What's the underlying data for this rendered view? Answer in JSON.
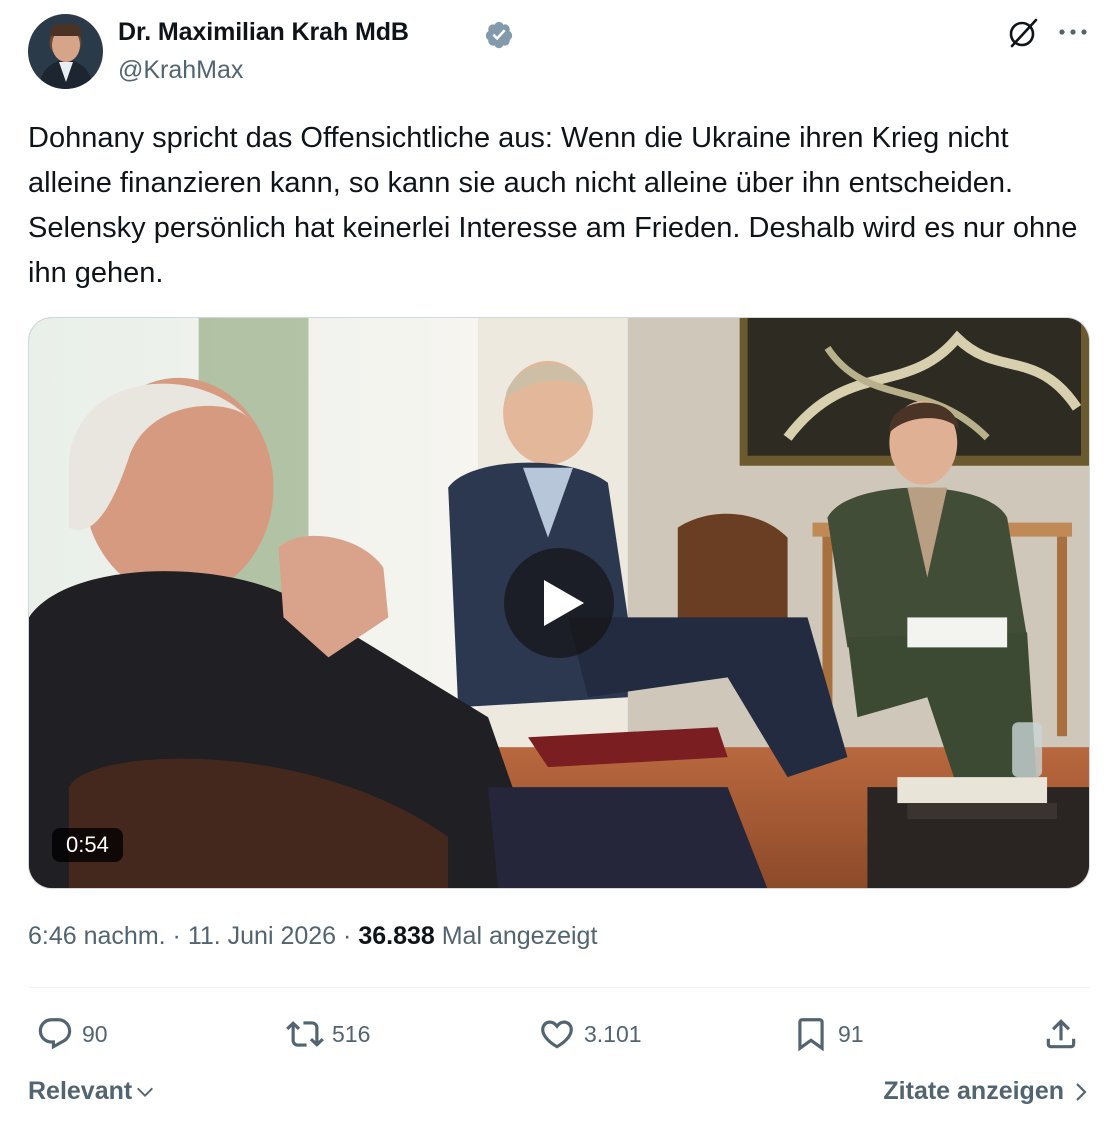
{
  "author": {
    "name": "Dr. Maximilian Krah MdB",
    "handle": "@KrahMax",
    "verified": true,
    "verified_color": "#829aab"
  },
  "header_icons": [
    "grok-icon",
    "more-icon"
  ],
  "tweet": {
    "text": "Dohnany spricht das Offensichtliche aus: Wenn die Ukraine ihren Krieg nicht alleine finanzieren kann, so kann sie auch nicht alleine über ihn entscheiden. Selensky persönlich hat keinerlei Interesse am Frieden. Deshalb wird es nur ohne ihn gehen."
  },
  "video": {
    "duration": "0:54",
    "play_icon": "play-icon"
  },
  "meta": {
    "time": "6:46 nachm.",
    "separator": " · ",
    "date": "11. Juni 2026",
    "views_count": "36.838",
    "views_label": "Mal angezeigt"
  },
  "actions": {
    "replies": "90",
    "reposts": "516",
    "likes": "3.101",
    "bookmarks": "91"
  },
  "footer": {
    "sort_label": "Relevant",
    "quotes_label": "Zitate anzeigen"
  },
  "colors": {
    "text_primary": "#0f1419",
    "text_secondary": "#536471",
    "divider": "#eff3f4"
  }
}
